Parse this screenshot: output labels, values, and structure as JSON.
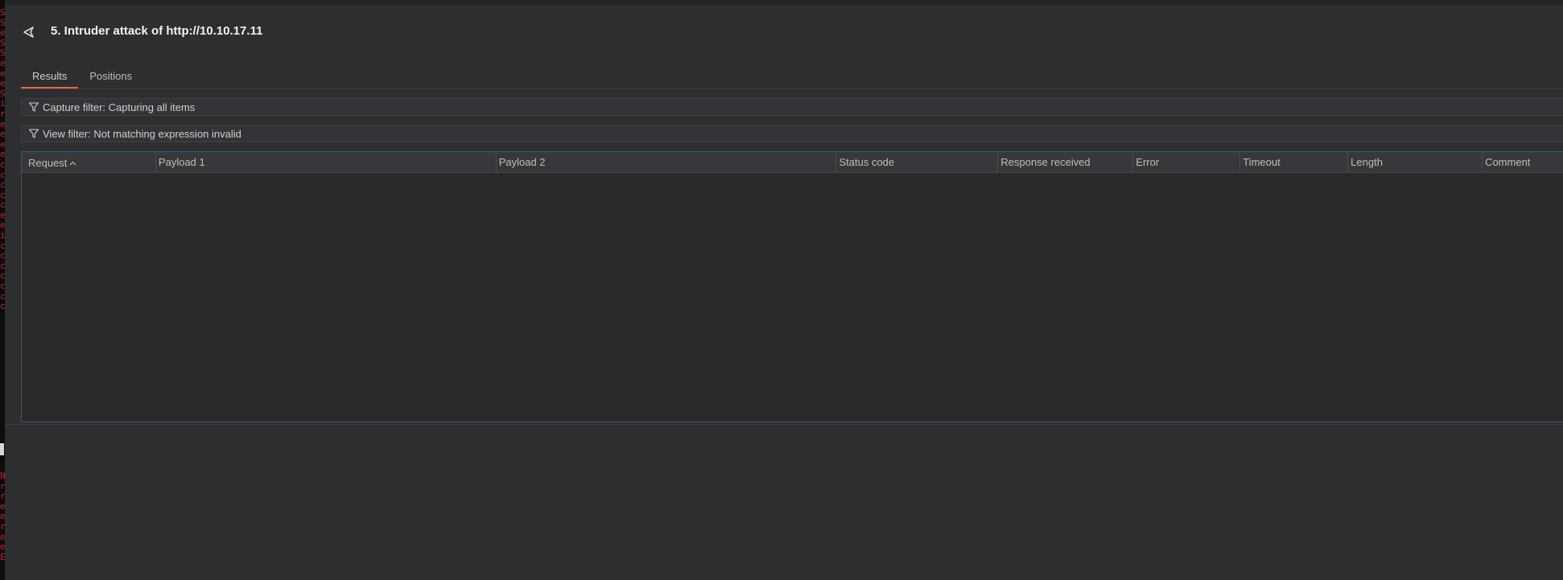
{
  "window": {
    "title": "5. Intruder attack of http://10.10.17.11"
  },
  "tabs": [
    {
      "label": "Results",
      "active": true
    },
    {
      "label": "Positions",
      "active": false
    }
  ],
  "filters": {
    "capture": "Capture filter: Capturing all items",
    "view": "View filter: Not matching expression invalid"
  },
  "table": {
    "columns": [
      {
        "label": "Request",
        "sorted": "ascending"
      },
      {
        "label": "Payload 1"
      },
      {
        "label": "Payload 2"
      },
      {
        "label": "Status code"
      },
      {
        "label": "Response received"
      },
      {
        "label": "Error"
      },
      {
        "label": "Timeout"
      },
      {
        "label": "Length"
      },
      {
        "label": "Comment"
      }
    ],
    "rows": []
  },
  "colors": {
    "background": "#2d2e30",
    "accent": "#e5693d",
    "table_border": "#3f5468",
    "terminal_glyph": "#c4242c"
  },
  "icons": {
    "back": "back-arrow-icon",
    "filter": "filter-funnel-icon",
    "sort": "chevron-up-icon"
  }
}
